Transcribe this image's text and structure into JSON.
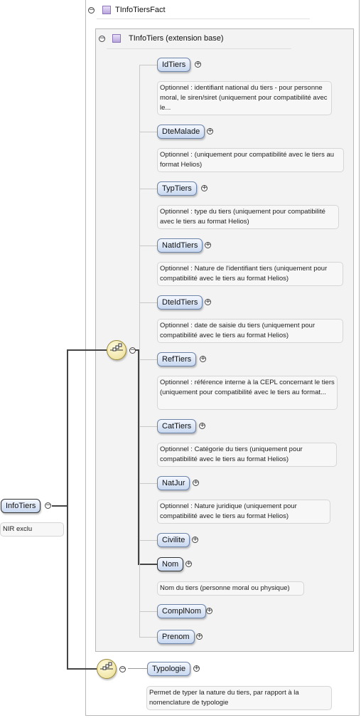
{
  "outer_type": {
    "label": "TInfoTiersFact"
  },
  "inner_type": {
    "label": "TInfoTiers (extension base)"
  },
  "root": {
    "label": "InfoTiers",
    "doc": "NIR exclu"
  },
  "elements": [
    {
      "label": "IdTiers",
      "doc": "Optionnel : identifiant national du tiers - pour personne moral, le siren/siret (uniquement pour compatibilité avec le..."
    },
    {
      "label": "DteMalade",
      "doc": "Optionnel : (uniquement pour compatibilité avec le tiers au format Helios)"
    },
    {
      "label": "TypTiers",
      "doc": "Optionnel : type du tiers (uniquement pour compatibilité avec le tiers au format Helios)"
    },
    {
      "label": "NatIdTiers",
      "doc": "Optionnel : Nature de l'identifiant tiers (uniquement pour compatibilité avec le tiers au format Helios)"
    },
    {
      "label": "DteIdTiers",
      "doc": "Optionnel : date de saisie du tiers (uniquement pour compatibilité avec le tiers au format Helios)"
    },
    {
      "label": "RefTiers",
      "doc": "Optionnel : référence interne à la CEPL concernant le tiers (uniquement pour compatibilité avec le tiers au format..."
    },
    {
      "label": "CatTiers",
      "doc": "Optionnel : Catégorie du tiers (uniquement pour compatibilité avec le tiers au format Helios)"
    },
    {
      "label": "NatJur",
      "doc": "Optionnel : Nature juridique (uniquement pour compatibilité avec le tiers au format Helios)"
    },
    {
      "label": "Civilite",
      "doc": ""
    },
    {
      "label": "Nom",
      "doc": "Nom du tiers (personne moral ou physique)"
    },
    {
      "label": "ComplNom",
      "doc": ""
    },
    {
      "label": "Prenom",
      "doc": ""
    }
  ],
  "typologie": {
    "label": "Typologie",
    "doc": "Permet de typer la nature du tiers, par rapport à la nomenclature de typologie"
  }
}
